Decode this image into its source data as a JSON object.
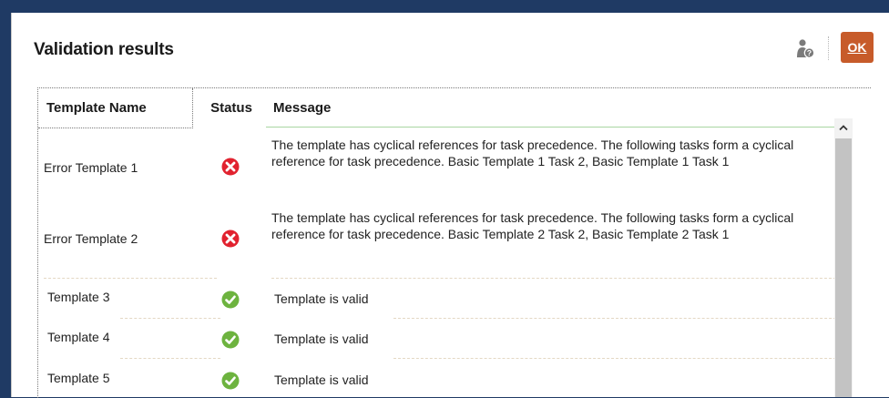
{
  "dialog": {
    "title": "Validation results",
    "ok_label": "OK",
    "help_icon": "user-help-icon"
  },
  "table": {
    "columns": [
      "Template Name",
      "Status",
      "Message"
    ],
    "rows": [
      {
        "name": "Error Template 1",
        "status": "error",
        "status_icon": "error-icon",
        "message": "The template has cyclical references for task precedence. The following tasks form a cyclical reference for task precedence. Basic Template 1 Task 2, Basic Template 1 Task 1"
      },
      {
        "name": "Error Template 2",
        "status": "error",
        "status_icon": "error-icon",
        "message": "The template has cyclical references for task precedence. The following tasks form a cyclical reference for task precedence. Basic Template 2 Task 2, Basic Template 2 Task 1"
      },
      {
        "name": "Template 3",
        "status": "valid",
        "status_icon": "check-icon",
        "message": "Template is valid"
      },
      {
        "name": "Template 4",
        "status": "valid",
        "status_icon": "check-icon",
        "message": "Template is valid"
      },
      {
        "name": "Template 5",
        "status": "valid",
        "status_icon": "check-icon",
        "message": "Template is valid"
      }
    ]
  },
  "colors": {
    "ok_button": "#c75b2a",
    "error": "#e1222f",
    "valid": "#6db33f",
    "header_rule": "#a9d6a2"
  }
}
